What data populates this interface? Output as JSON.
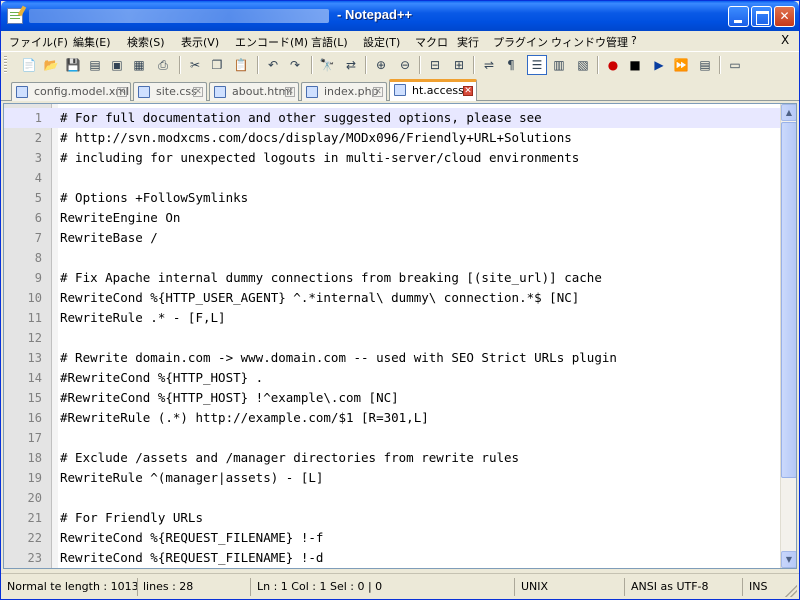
{
  "window": {
    "title": "- Notepad++"
  },
  "menu": [
    "ファイル(F)",
    "編集(E)",
    "検索(S)",
    "表示(V)",
    "エンコード(M)",
    "言語(L)",
    "設定(T)",
    "マクロ",
    "実行",
    "プラグイン",
    "ウィンドウ管理",
    "?"
  ],
  "menu_close": "X",
  "tabs": [
    {
      "label": "config.model.xml",
      "active": false
    },
    {
      "label": "site.css",
      "active": false
    },
    {
      "label": "about.html",
      "active": false
    },
    {
      "label": "index.php",
      "active": false
    },
    {
      "label": "ht.access",
      "active": true
    }
  ],
  "editor": {
    "current_line": 1,
    "lines": [
      "# For full documentation and other suggested options, please see",
      "# http://svn.modxcms.com/docs/display/MODx096/Friendly+URL+Solutions",
      "# including for unexpected logouts in multi-server/cloud environments",
      "",
      "# Options +FollowSymlinks",
      "RewriteEngine On",
      "RewriteBase /",
      "",
      "# Fix Apache internal dummy connections from breaking [(site_url)] cache",
      "RewriteCond %{HTTP_USER_AGENT} ^.*internal\\ dummy\\ connection.*$ [NC]",
      "RewriteRule .* - [F,L]",
      "",
      "# Rewrite domain.com -> www.domain.com -- used with SEO Strict URLs plugin",
      "#RewriteCond %{HTTP_HOST} .",
      "#RewriteCond %{HTTP_HOST} !^example\\.com [NC]",
      "#RewriteRule (.*) http://example.com/$1 [R=301,L]",
      "",
      "# Exclude /assets and /manager directories from rewrite rules",
      "RewriteRule ^(manager|assets) - [L]",
      "",
      "# For Friendly URLs",
      "RewriteCond %{REQUEST_FILENAME} !-f",
      "RewriteCond %{REQUEST_FILENAME} !-d"
    ],
    "line_numbers": [
      "1",
      "2",
      "3",
      "4",
      "5",
      "6",
      "7",
      "8",
      "9",
      "10",
      "11",
      "12",
      "13",
      "14",
      "15",
      "16",
      "17",
      "18",
      "19",
      "20",
      "21",
      "22",
      "23"
    ]
  },
  "status": {
    "type": "Normal te length : 1013",
    "lines": "lines : 28",
    "position": "Ln : 1    Col : 1    Sel : 0 | 0",
    "eol": "UNIX",
    "encoding": "ANSI as UTF-8",
    "mode": "INS"
  },
  "colors": {
    "title_bar": "#0a5ae6",
    "active_tab_accent": "#f0a030",
    "current_line": "#e8e8ff"
  },
  "icons": [
    "new-file-icon",
    "open-file-icon",
    "save-icon",
    "save-all-icon",
    "close-icon",
    "close-all-icon",
    "print-icon",
    "cut-icon",
    "copy-icon",
    "paste-icon",
    "undo-icon",
    "redo-icon",
    "find-icon",
    "replace-icon",
    "zoom-in-icon",
    "zoom-out-icon",
    "sync-v-icon",
    "sync-h-icon",
    "word-wrap-icon",
    "show-all-chars-icon",
    "indent-guide-icon",
    "user-lang-icon",
    "doc-map-icon",
    "func-list-icon",
    "record-macro-icon",
    "stop-macro-icon",
    "play-macro-icon",
    "run-macro-multiple-icon",
    "save-macro-icon",
    "launch-icon"
  ]
}
